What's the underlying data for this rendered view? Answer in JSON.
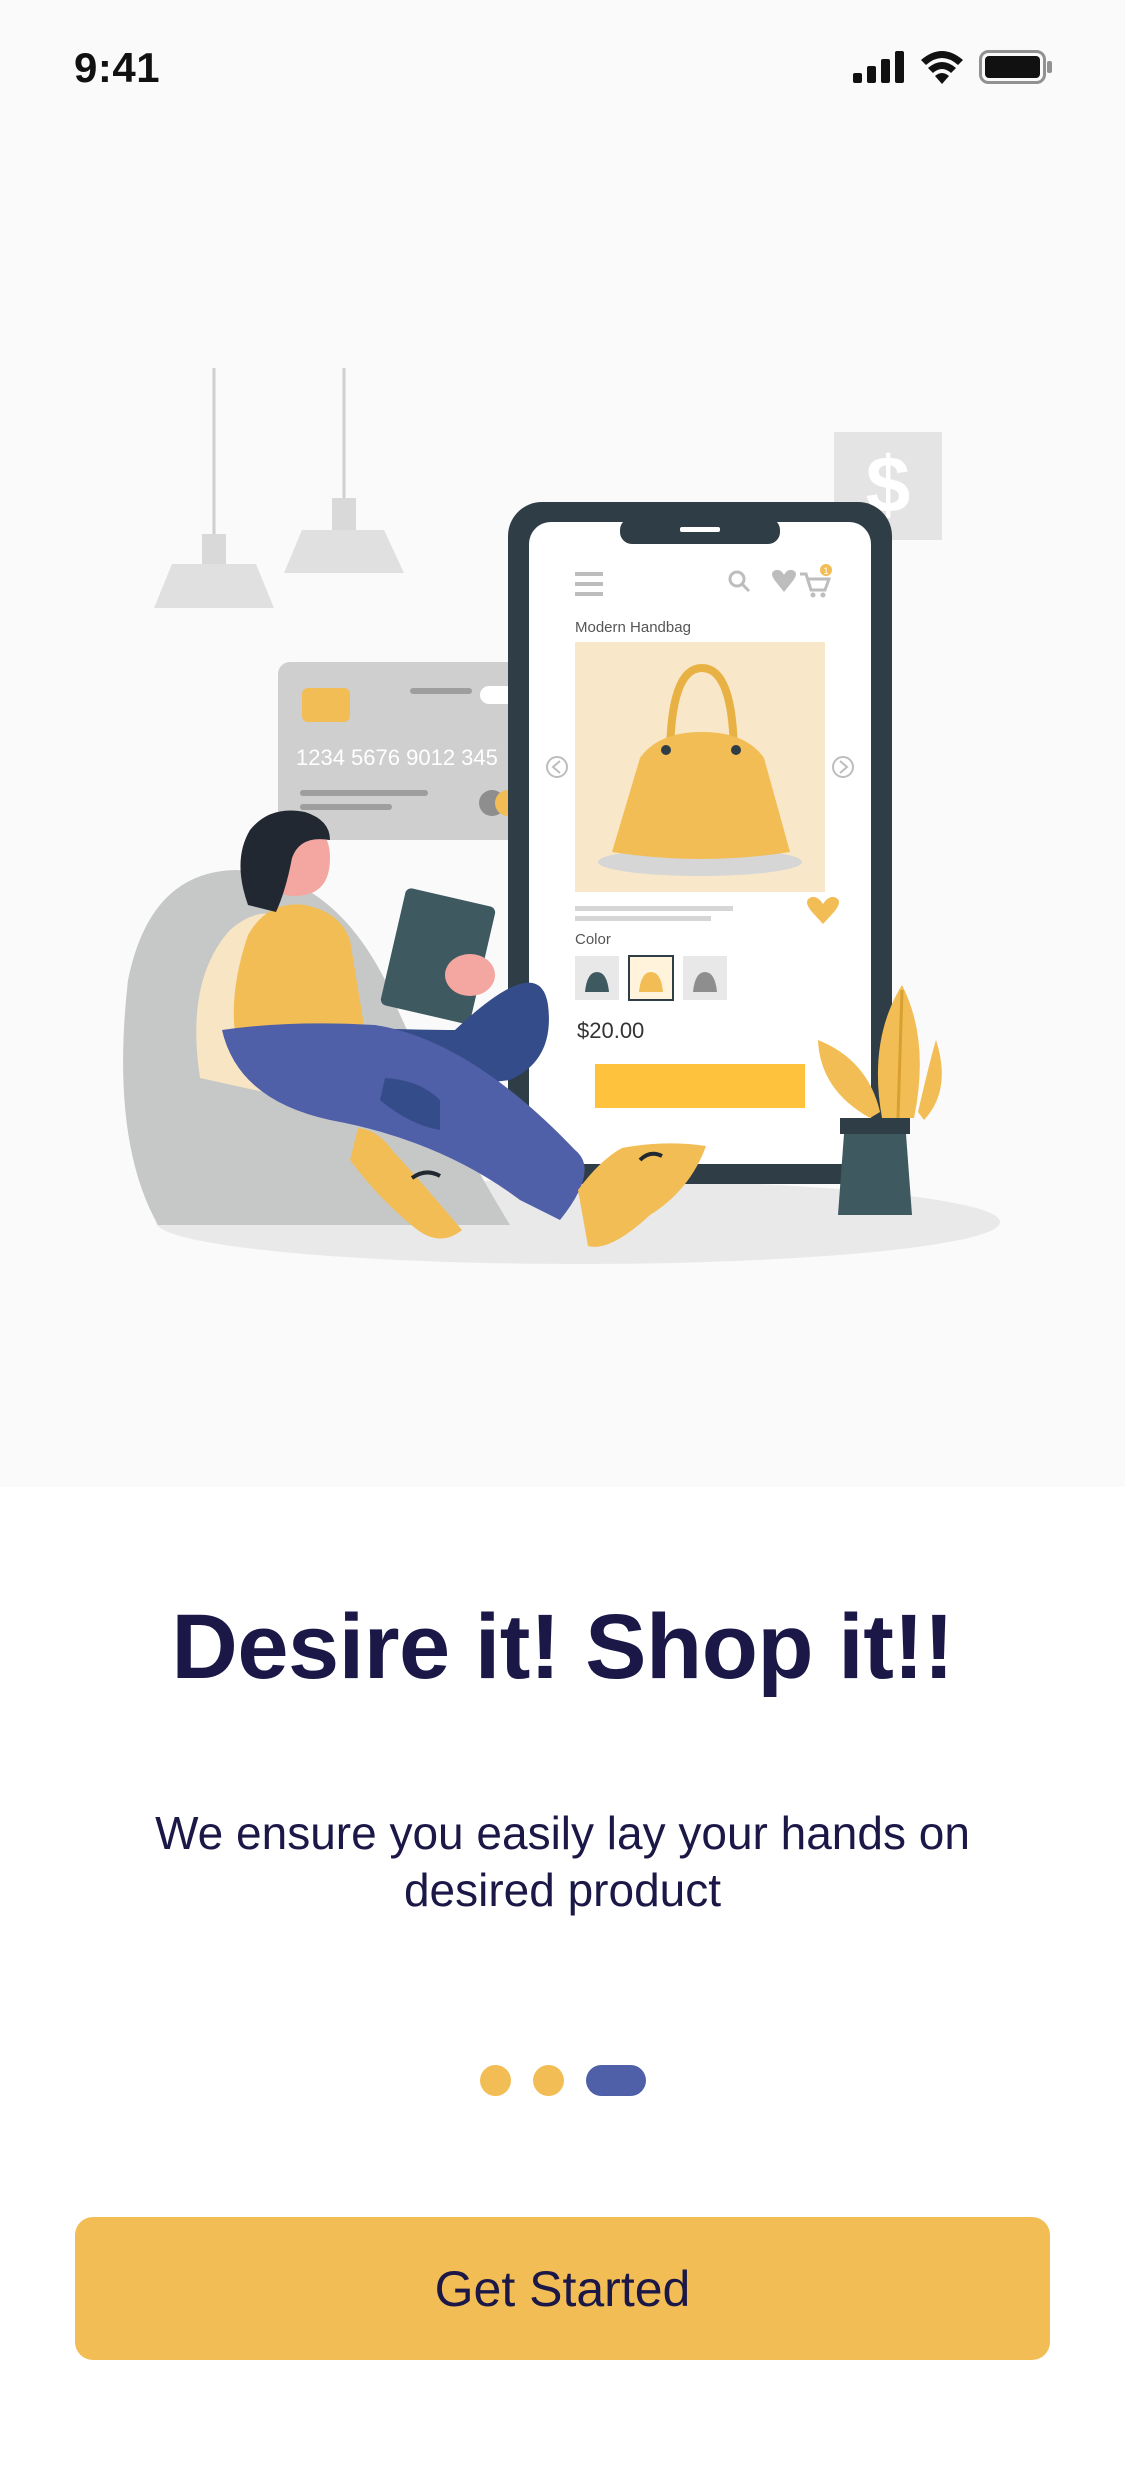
{
  "status_bar": {
    "time": "9:41"
  },
  "illustration": {
    "card_number": "1234 5676 9012 345",
    "screen_product_title": "Modern Handbag",
    "screen_color_label": "Color",
    "screen_price": "$20.00",
    "dollar_sign": "$",
    "cart_badge": "1"
  },
  "onboarding": {
    "title": "Desire it! Shop it!!",
    "subtitle": "We ensure you easily lay your hands on desired product",
    "page_count": 3,
    "current_page": 3
  },
  "cta": {
    "label": "Get Started"
  },
  "colors": {
    "accent": "#f2bd54",
    "indicator_active": "#4f5fa8",
    "text_dark": "#1b1848",
    "hero_background": "#fafafa"
  }
}
